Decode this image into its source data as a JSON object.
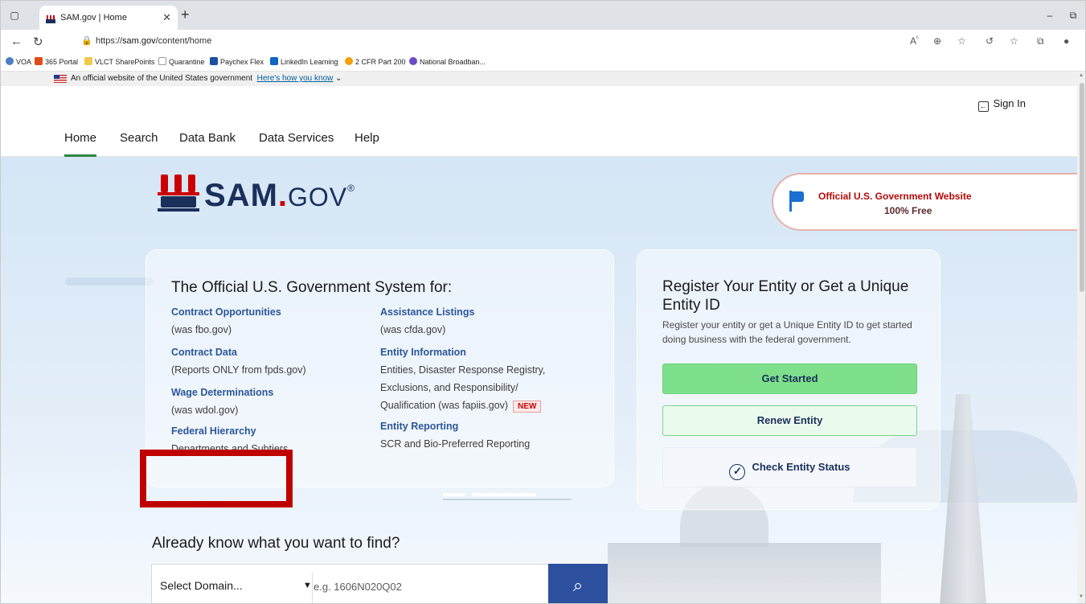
{
  "browser": {
    "tab_title": "SAM.gov | Home",
    "url_prefix": "https://",
    "url_host": "sam.gov",
    "url_path": "/content/home",
    "favorites": [
      "VOA",
      "365 Portal",
      "VLCT SharePoints",
      "Quarantine",
      "Paychex Flex",
      "LinkedIn Learning",
      "2 CFR Part 200",
      "National Broadban..."
    ]
  },
  "gov_banner": {
    "text": "An official website of the United States government",
    "link": "Here's how you know"
  },
  "header": {
    "signin": "Sign In"
  },
  "nav": {
    "items": [
      {
        "label": "Home",
        "active": true
      },
      {
        "label": "Search"
      },
      {
        "label": "Data Bank"
      },
      {
        "label": "Data Services"
      },
      {
        "label": "Help"
      }
    ]
  },
  "logo": {
    "sam": "SAM",
    "dot": ".",
    "gov": "GOV",
    "reg": "®"
  },
  "official": {
    "line1": "Official U.S. Government Website",
    "line2": "100% Free"
  },
  "system": {
    "title": "The Official U.S. Government System for:",
    "left": [
      {
        "title": "Contract Opportunities",
        "sub": "(was fbo.gov)"
      },
      {
        "title": "Contract Data",
        "sub": "(Reports ONLY from fpds.gov)"
      },
      {
        "title": "Wage Determinations",
        "sub": "(was wdol.gov)"
      },
      {
        "title": "Federal Hierarchy",
        "sub": "Departments and Subtiers"
      }
    ],
    "right": [
      {
        "title": "Assistance Listings",
        "sub": "(was cfda.gov)"
      },
      {
        "title": "Entity Information",
        "sub1": "Entities, Disaster Response Registry,",
        "sub2": "Exclusions, and Responsibility/",
        "sub3": "Qualification (was fapiis.gov)",
        "badge": "NEW"
      },
      {
        "title": "Entity Reporting",
        "sub": "SCR and Bio-Preferred Reporting"
      }
    ]
  },
  "register": {
    "title": "Register Your Entity or Get a Unique Entity ID",
    "desc": "Register your entity or get a Unique Entity ID to get started doing business with the federal government.",
    "get_started": "Get Started",
    "renew": "Renew Entity",
    "check": "Check Entity Status"
  },
  "find": {
    "title": "Already know what you want to find?",
    "domain": "Select Domain...",
    "placeholder": "e.g. 1606N020Q02"
  }
}
